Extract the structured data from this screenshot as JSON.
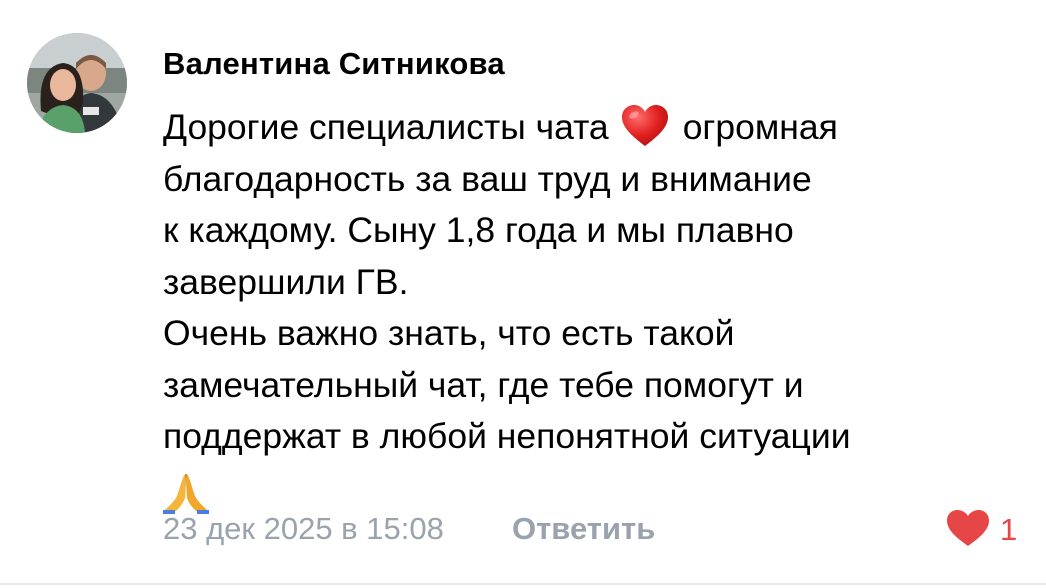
{
  "comment": {
    "author": "Валентина Ситникова",
    "avatar_icon": "avatar-photo",
    "text_lines": [
      "Дорогие специалисты чата",
      "огромная",
      "благодарность за ваш труд и внимание",
      "к каждому. Сыну 1,8 года и мы плавно",
      "завершили ГВ.",
      "Очень важно знать, что есть такой",
      "замечательный чат, где тебе помогут и",
      "поддержат в любой непонятной ситуации"
    ],
    "emojis": [
      "red-heart-emoji",
      "folded-hands-emoji"
    ],
    "timestamp": "23 дек 2025 в 15:08",
    "reply_label": "Ответить",
    "likes_count": "1",
    "like_icon": "heart-icon"
  },
  "colors": {
    "secondary_text": "#99a2ad",
    "like_red": "#e64646",
    "divider": "#e7e8ec"
  }
}
